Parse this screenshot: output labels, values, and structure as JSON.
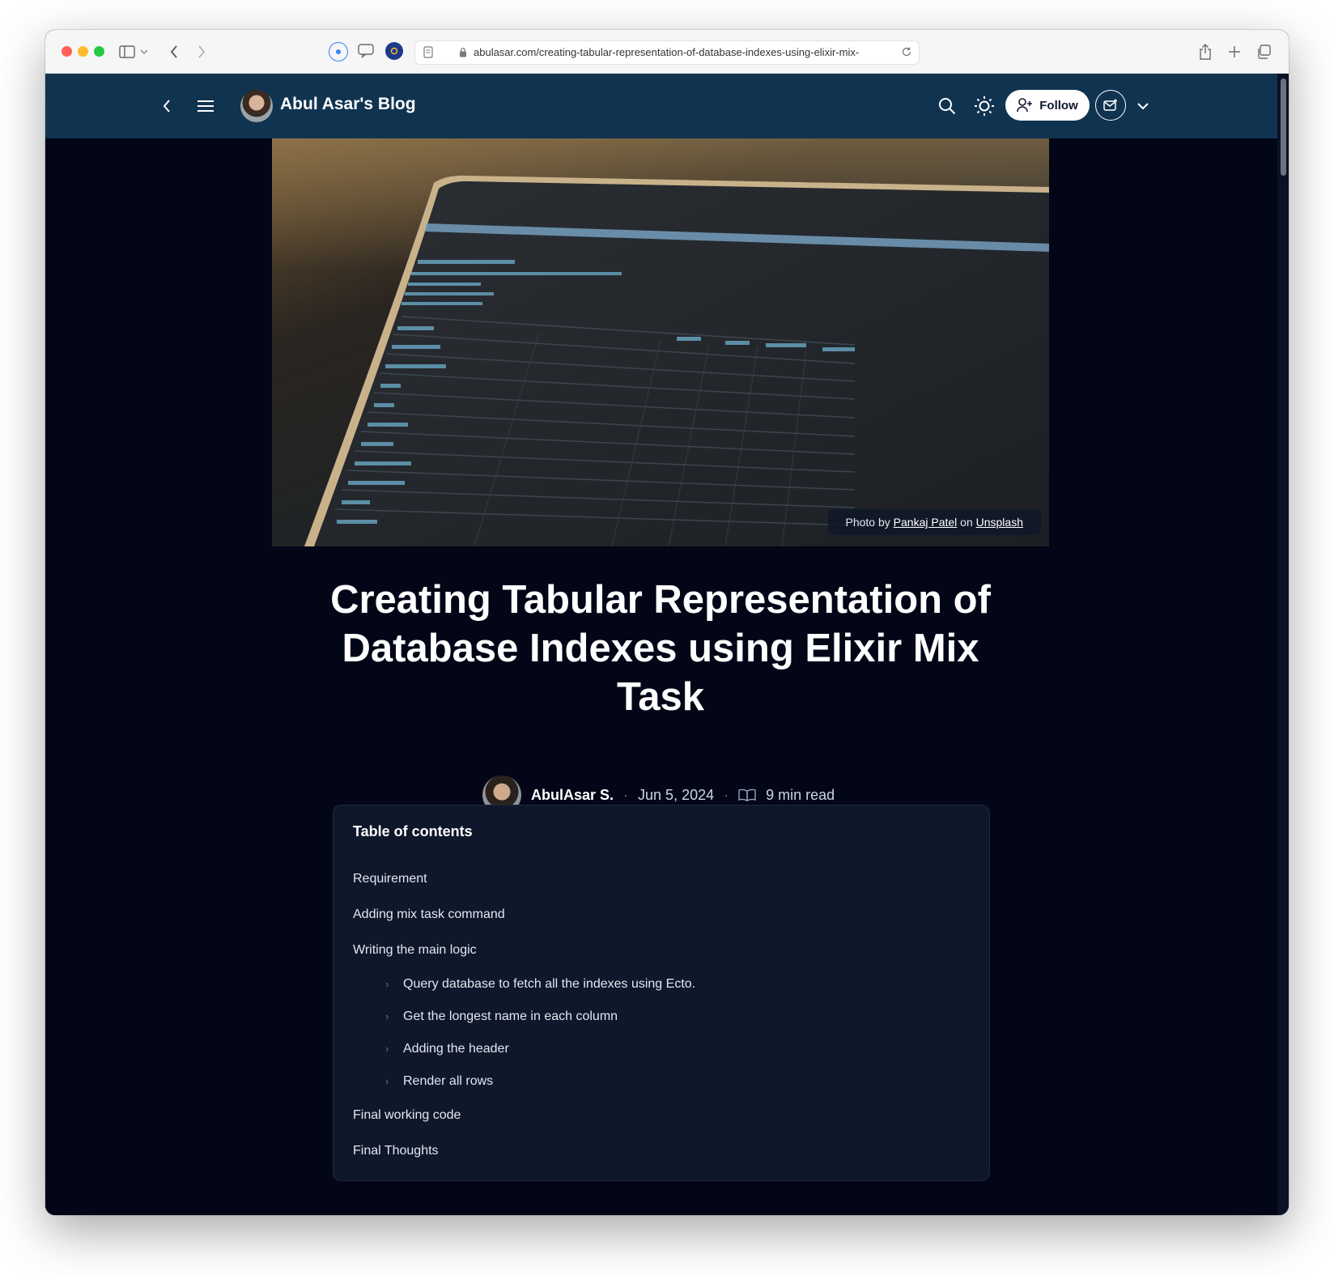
{
  "browser": {
    "url": "abulasar.com/creating-tabular-representation-of-database-indexes-using-elixir-mix-"
  },
  "header": {
    "blog_title": "Abul Asar's Blog",
    "follow_label": "Follow"
  },
  "cover": {
    "credit_prefix": "Photo by",
    "credit_author": "Pankaj Patel",
    "credit_middle": "on",
    "credit_site": "Unsplash"
  },
  "post": {
    "title": "Creating Tabular Representation of Database Indexes using Elixir Mix Task",
    "author": "AbulAsar S.",
    "date": "Jun 5, 2024",
    "read_time": "9 min read"
  },
  "toc": {
    "title": "Table of contents",
    "items": [
      {
        "label": "Requirement"
      },
      {
        "label": "Adding mix task command"
      },
      {
        "label": "Writing the main logic"
      },
      {
        "label": "Query database to fetch all the indexes using Ecto."
      },
      {
        "label": "Get the longest name in each column"
      },
      {
        "label": "Adding the header"
      },
      {
        "label": "Render all rows"
      },
      {
        "label": "Final working code"
      },
      {
        "label": "Final Thoughts"
      }
    ]
  }
}
